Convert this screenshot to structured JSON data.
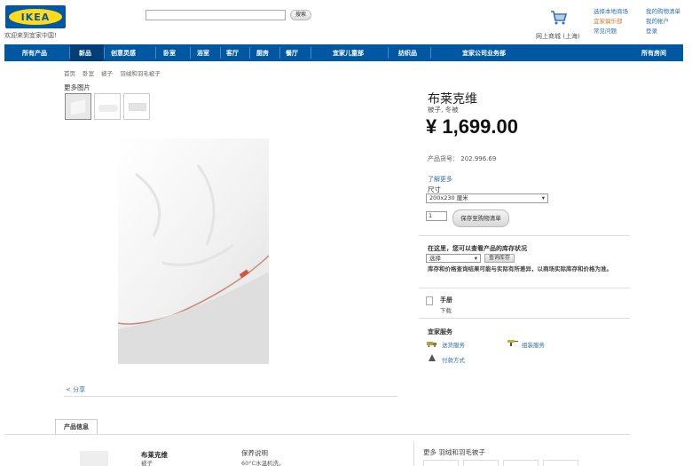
{
  "header": {
    "logo": "IKEA",
    "welcome": "欢迎来到宜家中国!",
    "search": {
      "value": "",
      "button_label": "搜索"
    },
    "cart_label": "网上商城 (上海)",
    "links_col1": [
      "选择本地商场",
      "宜家俱乐部",
      "常见问题"
    ],
    "links_col2": [
      "我的购物清单",
      "我的帐户",
      "登录"
    ]
  },
  "nav": {
    "items": [
      "所有产品",
      "新品",
      "创意灵感",
      "卧室",
      "浴室",
      "客厅",
      "厨房",
      "餐厅",
      "宜家儿童部",
      "纺织品",
      "宜家公司业务部",
      "所有房间"
    ],
    "active_index": 1
  },
  "breadcrumb": [
    "首页",
    "卧室",
    "被子",
    "羽绒和羽毛被子"
  ],
  "gallery": {
    "title": "更多图片"
  },
  "share_label": "分享",
  "product": {
    "name": "布莱克维",
    "subtitle": "被子, 冬被",
    "price": "¥ 1,699.00",
    "article_label": "产品货号：",
    "article_no": "202.996.69",
    "learn_more": "了解更多",
    "size_label": "尺寸",
    "size_value": "200x230 厘米",
    "quantity": "1",
    "add_button": "保存至购物清单"
  },
  "stock": {
    "prompt": "在这里，您可以查看产品的库存状况",
    "select_value": "选择",
    "check_button": "查询库存",
    "note": "库存和价格查询结果可能与实际有所差异，以商场实际库存和价格为准。"
  },
  "manual": {
    "label": "手册",
    "link": "下载"
  },
  "services": {
    "title": "宜家服务",
    "items": [
      "送货服务",
      "组装服务",
      "付款方式"
    ]
  },
  "tabs": {
    "product_info": "产品信息"
  },
  "info": {
    "name": "布莱克维",
    "sub": "被子",
    "care_title": "保养说明",
    "care_sub": "60°C水温机洗。",
    "more_title": "更多 羽绒和羽毛被子"
  },
  "colors": {
    "brand_blue": "#0058a3",
    "brand_yellow": "#ffda1a",
    "link": "#2f6fb0"
  }
}
